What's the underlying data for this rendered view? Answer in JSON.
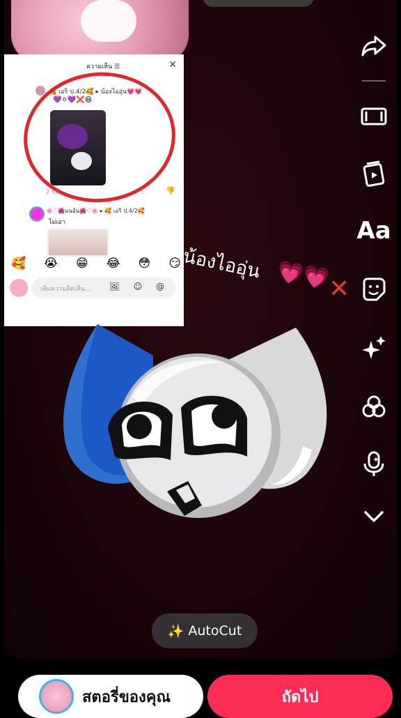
{
  "card": {
    "title": "ความเห็น ☰",
    "comment_header": "🥰 เอริ ป.4/2🥰 ▸ น้องไออุ่น💗💗",
    "comment_emojis": "💜⚪💜❌😆",
    "meta": "2 ชม.",
    "reply_header": "🌸♡🌺มนอ้น🌺♡🌸 ▸ 🥰 เอริ ป.4/2🥰",
    "reply_text": "ไม่เอา",
    "reactions": [
      "🥰",
      "😭",
      "😁",
      "😂",
      "😳",
      "😏"
    ],
    "input_placeholder": "เพิ่มความคิดเห็น...",
    "input_icons": "🖼 ☺ @"
  },
  "sticker_text": "น้องไออุ่น",
  "sticker_hearts": "💗💗",
  "sticker_cross": "✕",
  "autocut": {
    "icon": "sparkle-icon",
    "label": "AutoCut"
  },
  "toolbar": [
    {
      "name": "share-icon"
    },
    {
      "name": "resize-icon"
    },
    {
      "name": "template-icon"
    },
    {
      "name": "text-tool",
      "label": "Aa"
    },
    {
      "name": "sticker-icon"
    },
    {
      "name": "effects-icon"
    },
    {
      "name": "filters-icon"
    },
    {
      "name": "voice-icon"
    },
    {
      "name": "chevron-down-icon"
    }
  ],
  "bottom": {
    "story_label": "สตอรี่ของคุณ",
    "next_label": "ถัดไป"
  },
  "colors": {
    "next_button": "#fd2c55",
    "canvas": "#1c0509",
    "circle": "#e3252c"
  }
}
